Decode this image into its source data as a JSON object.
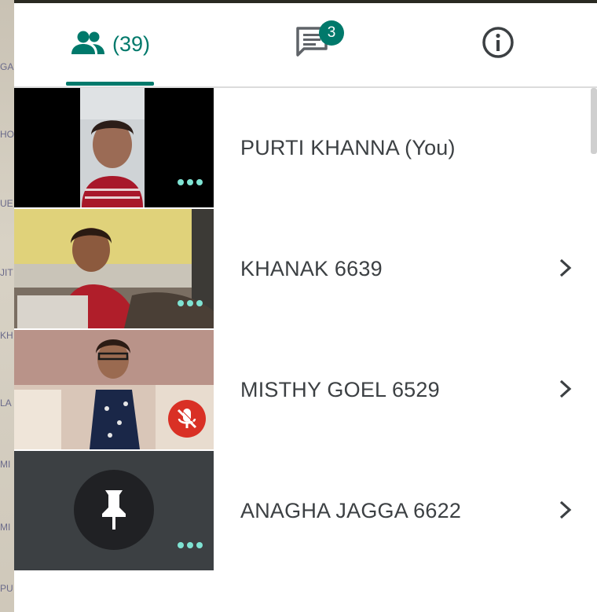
{
  "tabs": {
    "people": {
      "icon": "people-icon",
      "count_label": "(39)"
    },
    "chat": {
      "icon": "chat-icon",
      "badge": "3"
    },
    "info": {
      "icon": "info-icon"
    }
  },
  "participants": [
    {
      "name": "PURTI KHANNA (You)",
      "tile": "video",
      "has_chevron": false,
      "tile_overlay": "more-dots"
    },
    {
      "name": "KHANAK 6639",
      "tile": "video",
      "has_chevron": true,
      "tile_overlay": "more-dots"
    },
    {
      "name": "MISTHY GOEL 6529",
      "tile": "video",
      "has_chevron": true,
      "tile_overlay": "mic-muted-icon"
    },
    {
      "name": "ANAGHA JAGGA 6622",
      "tile": "pinned-placeholder",
      "has_chevron": true,
      "tile_overlay": "more-dots"
    }
  ],
  "colors": {
    "accent": "#00796b",
    "muted_red": "#d93025",
    "dots": "#7fe3d3",
    "tile_placeholder_bg": "#3c4043",
    "text": "#3c4043"
  }
}
